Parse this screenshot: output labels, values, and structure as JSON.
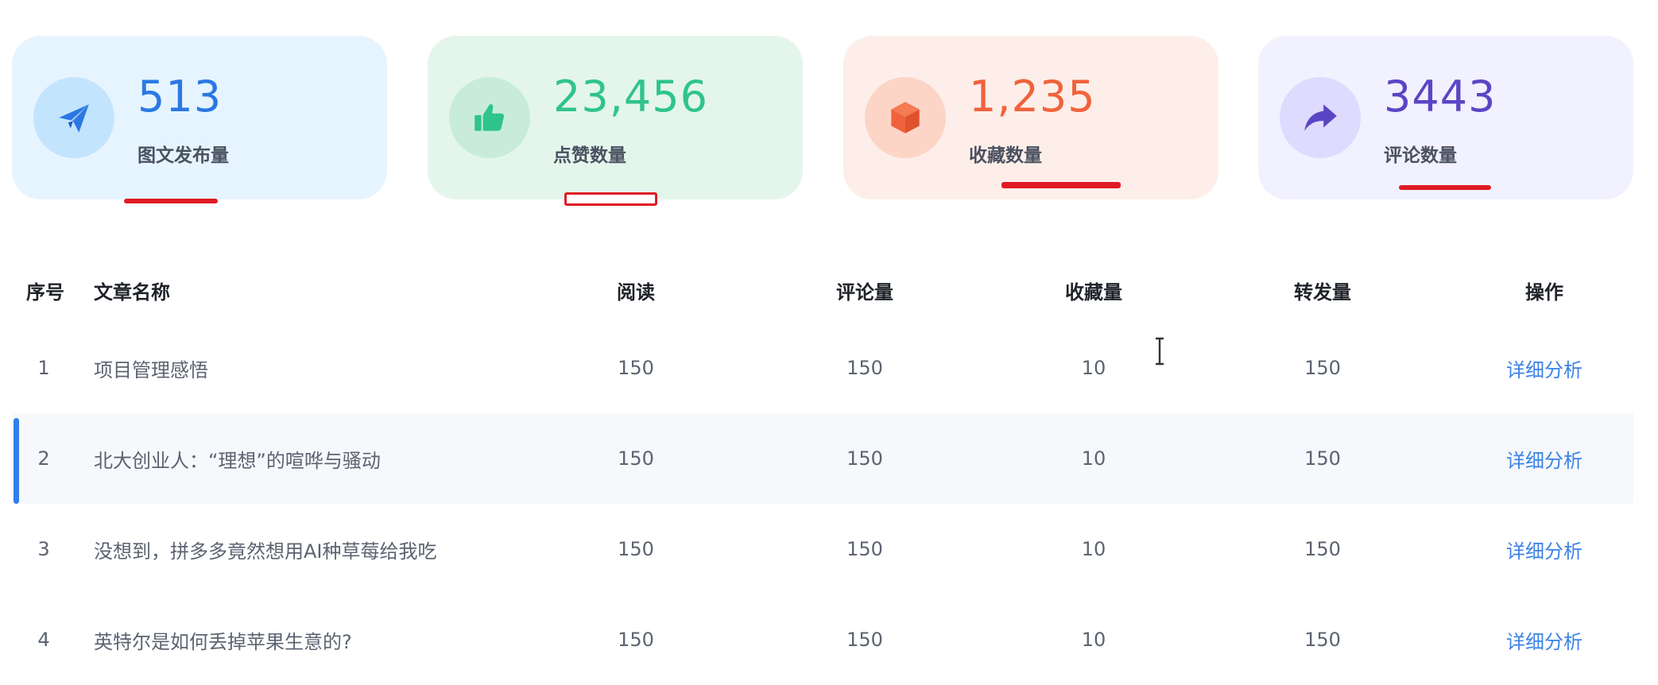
{
  "stats": [
    {
      "value": "513",
      "label": "图文发布量",
      "icon": "paper-plane-icon",
      "color": "#2a78e4"
    },
    {
      "value": "23,456",
      "label": "点赞数量",
      "icon": "thumbs-up-icon",
      "color": "#2fc48a"
    },
    {
      "value": "1,235",
      "label": "收藏数量",
      "icon": "cube-icon",
      "color": "#f0623c"
    },
    {
      "value": "3443",
      "label": "评论数量",
      "icon": "share-arrow-icon",
      "color": "#5b45c4"
    }
  ],
  "table": {
    "headers": {
      "index": "序号",
      "title": "文章名称",
      "reads": "阅读",
      "comments": "评论量",
      "favorites": "收藏量",
      "forwards": "转发量",
      "action": "操作"
    },
    "rows": [
      {
        "index": "1",
        "title": "项目管理感悟",
        "reads": "150",
        "comments": "150",
        "favorites": "10",
        "forwards": "150",
        "action": "详细分析"
      },
      {
        "index": "2",
        "title": "北大创业人：“理想”的喧哗与骚动",
        "reads": "150",
        "comments": "150",
        "favorites": "10",
        "forwards": "150",
        "action": "详细分析"
      },
      {
        "index": "3",
        "title": "没想到，拼多多竟然想用AI种草莓给我吃",
        "reads": "150",
        "comments": "150",
        "favorites": "10",
        "forwards": "150",
        "action": "详细分析"
      },
      {
        "index": "4",
        "title": "英特尔是如何丢掉苹果生意的?",
        "reads": "150",
        "comments": "150",
        "favorites": "10",
        "forwards": "150",
        "action": "详细分析"
      }
    ],
    "highlighted_row": 2,
    "accent_color": "#2f80ed"
  }
}
